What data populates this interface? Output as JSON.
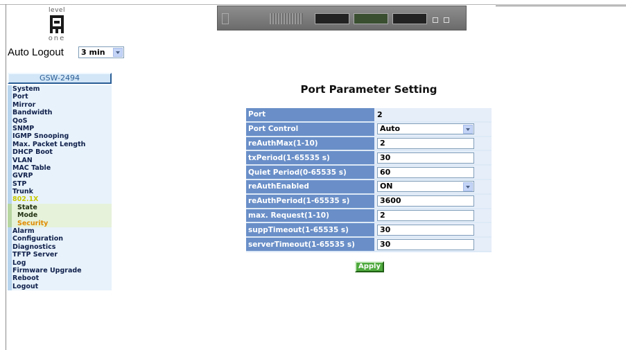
{
  "logo": {
    "top_text": "level",
    "bottom_text": "one"
  },
  "auto_logout": {
    "label": "Auto Logout",
    "selected": "3 min"
  },
  "device_image": "switch-front-panel",
  "model": "GSW-2494",
  "menu": [
    {
      "label": "System"
    },
    {
      "label": "Port"
    },
    {
      "label": "Mirror"
    },
    {
      "label": "Bandwidth"
    },
    {
      "label": "QoS"
    },
    {
      "label": "SNMP"
    },
    {
      "label": "IGMP Snooping"
    },
    {
      "label": "Max. Packet Length"
    },
    {
      "label": "DHCP Boot"
    },
    {
      "label": "VLAN"
    },
    {
      "label": "MAC Table"
    },
    {
      "label": "GVRP"
    },
    {
      "label": "STP"
    },
    {
      "label": "Trunk"
    },
    {
      "label": "802.1X"
    },
    {
      "label": "State"
    },
    {
      "label": "Mode"
    },
    {
      "label": "Security"
    },
    {
      "label": "Alarm"
    },
    {
      "label": "Configuration"
    },
    {
      "label": "Diagnostics"
    },
    {
      "label": "TFTP Server"
    },
    {
      "label": "Log"
    },
    {
      "label": "Firmware Upgrade"
    },
    {
      "label": "Reboot"
    },
    {
      "label": "Logout"
    }
  ],
  "page_title": "Port Parameter Setting",
  "params": [
    {
      "label": "Port",
      "value": "2"
    },
    {
      "label": "Port Control",
      "value": "Auto"
    },
    {
      "label": "reAuthMax(1-10)",
      "value": "2"
    },
    {
      "label": "txPeriod(1-65535 s)",
      "value": "30"
    },
    {
      "label": "Quiet Period(0-65535 s)",
      "value": "60"
    },
    {
      "label": "reAuthEnabled",
      "value": "ON"
    },
    {
      "label": "reAuthPeriod(1-65535 s)",
      "value": "3600"
    },
    {
      "label": "max. Request(1-10)",
      "value": "2"
    },
    {
      "label": "suppTimeout(1-65535 s)",
      "value": "30"
    },
    {
      "label": "serverTimeout(1-65535 s)",
      "value": "30"
    }
  ],
  "apply_label": "Apply",
  "colors": {
    "label_cell": "#6a8fc8",
    "menu_bg": "#e7f2fb",
    "submenu_bg": "#e6f2da",
    "active_item": "#e08a00",
    "open_group": "#c8c800",
    "apply_button": "#4faa3e"
  }
}
